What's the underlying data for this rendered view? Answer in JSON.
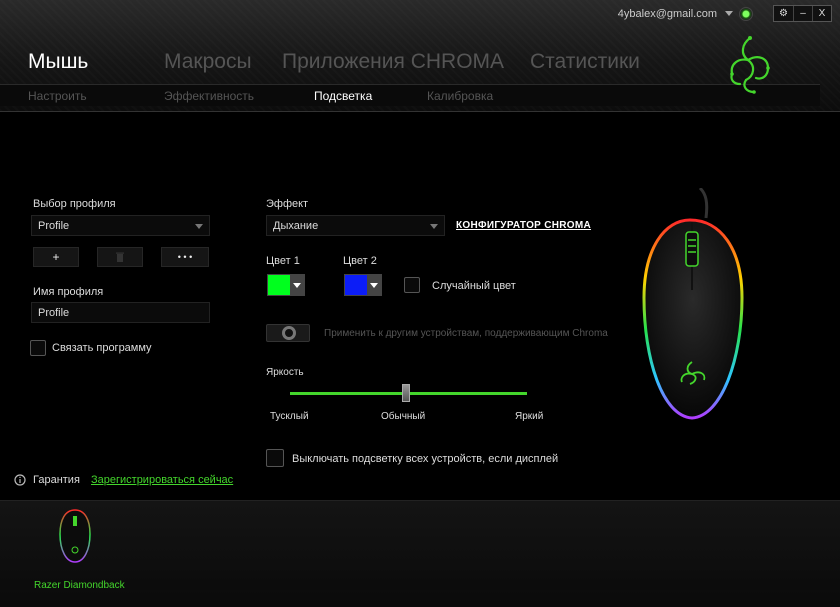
{
  "header": {
    "email": "4ybalex@gmail.com",
    "window_buttons": [
      "⚙",
      "–",
      "X"
    ],
    "tabs": [
      "Мышь",
      "Макросы",
      "Приложения CHROMA",
      "Статистики"
    ],
    "active_tab": 0,
    "subtabs": [
      "Настроить",
      "Эффективность",
      "Подсветка",
      "Калибровка"
    ],
    "active_subtab": 2
  },
  "profile": {
    "select_label": "Выбор профиля",
    "select_value": "Profile",
    "add_button": "+",
    "more_button": "• • •",
    "name_label": "Имя профиля",
    "name_value": "Profile",
    "link_program_label": "Связать программу"
  },
  "effect": {
    "label": "Эффект",
    "value": "Дыхание",
    "configurator_link": "КОНФИГУРАТОР CHROMA",
    "color1_label": "Цвет 1",
    "color1": "#00ff1e",
    "color2_label": "Цвет 2",
    "color2": "#0c1df7",
    "random_color_label": "Случайный цвет",
    "apply_label": "Применить к другим устройствам, поддерживающим Chroma"
  },
  "brightness": {
    "label": "Яркость",
    "level": 0.5,
    "min_label": "Тусклый",
    "mid_label": "Обычный",
    "max_label": "Яркий"
  },
  "turn_off_label": "Выключать подсветку всех устройств, если дисплей",
  "warranty": {
    "label": "Гарантия",
    "register_link": "Зарегистрироваться сейчас"
  },
  "device": {
    "name": "Razer Diamondback"
  },
  "colors": {
    "accent": "#44d62c"
  }
}
